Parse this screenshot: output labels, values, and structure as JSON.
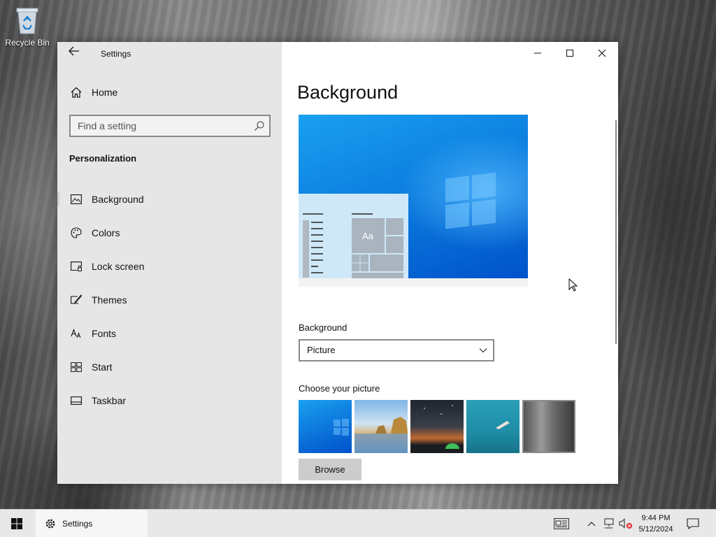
{
  "desktop": {
    "recycle_bin_label": "Recycle Bin"
  },
  "window": {
    "title": "Settings",
    "controls": {
      "minimize": "—",
      "maximize": "☐",
      "close": "✕"
    }
  },
  "sidebar": {
    "home_label": "Home",
    "search_placeholder": "Find a setting",
    "section_title": "Personalization",
    "items": [
      {
        "label": "Background",
        "icon": "image-icon",
        "selected": true
      },
      {
        "label": "Colors",
        "icon": "palette-icon",
        "selected": false
      },
      {
        "label": "Lock screen",
        "icon": "lock-screen-icon",
        "selected": false
      },
      {
        "label": "Themes",
        "icon": "themes-icon",
        "selected": false
      },
      {
        "label": "Fonts",
        "icon": "fonts-icon",
        "selected": false
      },
      {
        "label": "Start",
        "icon": "start-icon",
        "selected": false
      },
      {
        "label": "Taskbar",
        "icon": "taskbar-icon",
        "selected": false
      }
    ]
  },
  "content": {
    "page_title": "Background",
    "preview_sample_text": "Aa",
    "background_label": "Background",
    "background_value": "Picture",
    "choose_label": "Choose your picture",
    "browse_label": "Browse"
  },
  "taskbar": {
    "app_label": "Settings",
    "time": "9:44 PM",
    "date": "5/12/2024"
  },
  "colors": {
    "sidebar_bg": "#e6e6e6",
    "accent_blue": "#0c7ee0",
    "taskbar_bg": "#e8e8e8"
  }
}
